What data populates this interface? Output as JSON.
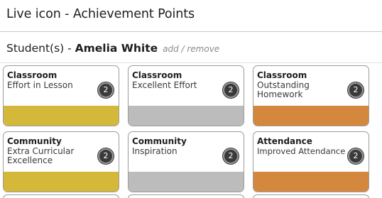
{
  "header": {
    "title": "Live icon - Achievement Points"
  },
  "students": {
    "prefix": "Student(s) - ",
    "name": "Amelia White",
    "add_remove": "add / remove"
  },
  "cards": [
    {
      "category": "Classroom",
      "description": "Effort in Lesson",
      "count": "2",
      "color": "#d4b83a"
    },
    {
      "category": "Classroom",
      "description": "Excellent Effort",
      "count": "2",
      "color": "#bcbcbc"
    },
    {
      "category": "Classroom",
      "description": "Outstanding Homework",
      "count": "2",
      "color": "#d4883e"
    },
    {
      "category": "Community",
      "description": "Extra Curricular Excellence",
      "count": "2",
      "color": "#d4b83a"
    },
    {
      "category": "Community",
      "description": "Inspiration",
      "count": "2",
      "color": "#bcbcbc"
    },
    {
      "category": "Attendance",
      "description": "Improved Attendance",
      "count": "2",
      "color": "#d4883e"
    }
  ]
}
